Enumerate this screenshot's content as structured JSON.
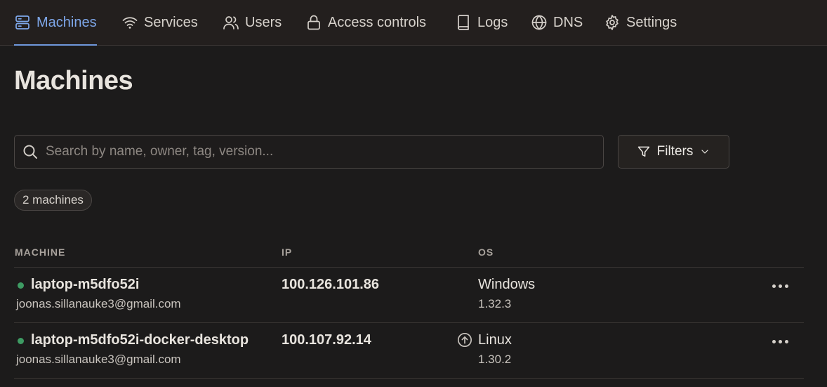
{
  "nav": {
    "tabs": [
      {
        "label": "Machines",
        "icon": "server-icon",
        "active": true
      },
      {
        "label": "Services",
        "icon": "wifi-icon"
      },
      {
        "label": "Users",
        "icon": "users-icon"
      },
      {
        "label": "Access controls",
        "icon": "lock-icon"
      },
      {
        "label": "Logs",
        "icon": "book-icon"
      },
      {
        "label": "DNS",
        "icon": "globe-icon"
      },
      {
        "label": "Settings",
        "icon": "gear-icon"
      }
    ]
  },
  "page": {
    "title": "Machines"
  },
  "search": {
    "placeholder": "Search by name, owner, tag, version...",
    "value": ""
  },
  "filters": {
    "label": "Filters"
  },
  "count_badge": "2 machines",
  "table": {
    "columns": [
      "MACHINE",
      "IP",
      "OS"
    ],
    "rows": [
      {
        "name": "laptop-m5dfo52i",
        "owner": "joonas.sillanauke3@gmail.com",
        "ip": "100.126.101.86",
        "os": "Windows",
        "version": "1.32.3",
        "online": true,
        "update_available": false
      },
      {
        "name": "laptop-m5dfo52i-docker-desktop",
        "owner": "joonas.sillanauke3@gmail.com",
        "ip": "100.107.92.14",
        "os": "Linux",
        "version": "1.30.2",
        "online": true,
        "update_available": true
      }
    ]
  },
  "colors": {
    "accent": "#7ea7ea",
    "online": "#3e9b63",
    "background": "#1c1b1b",
    "nav_background": "#231f1e"
  }
}
